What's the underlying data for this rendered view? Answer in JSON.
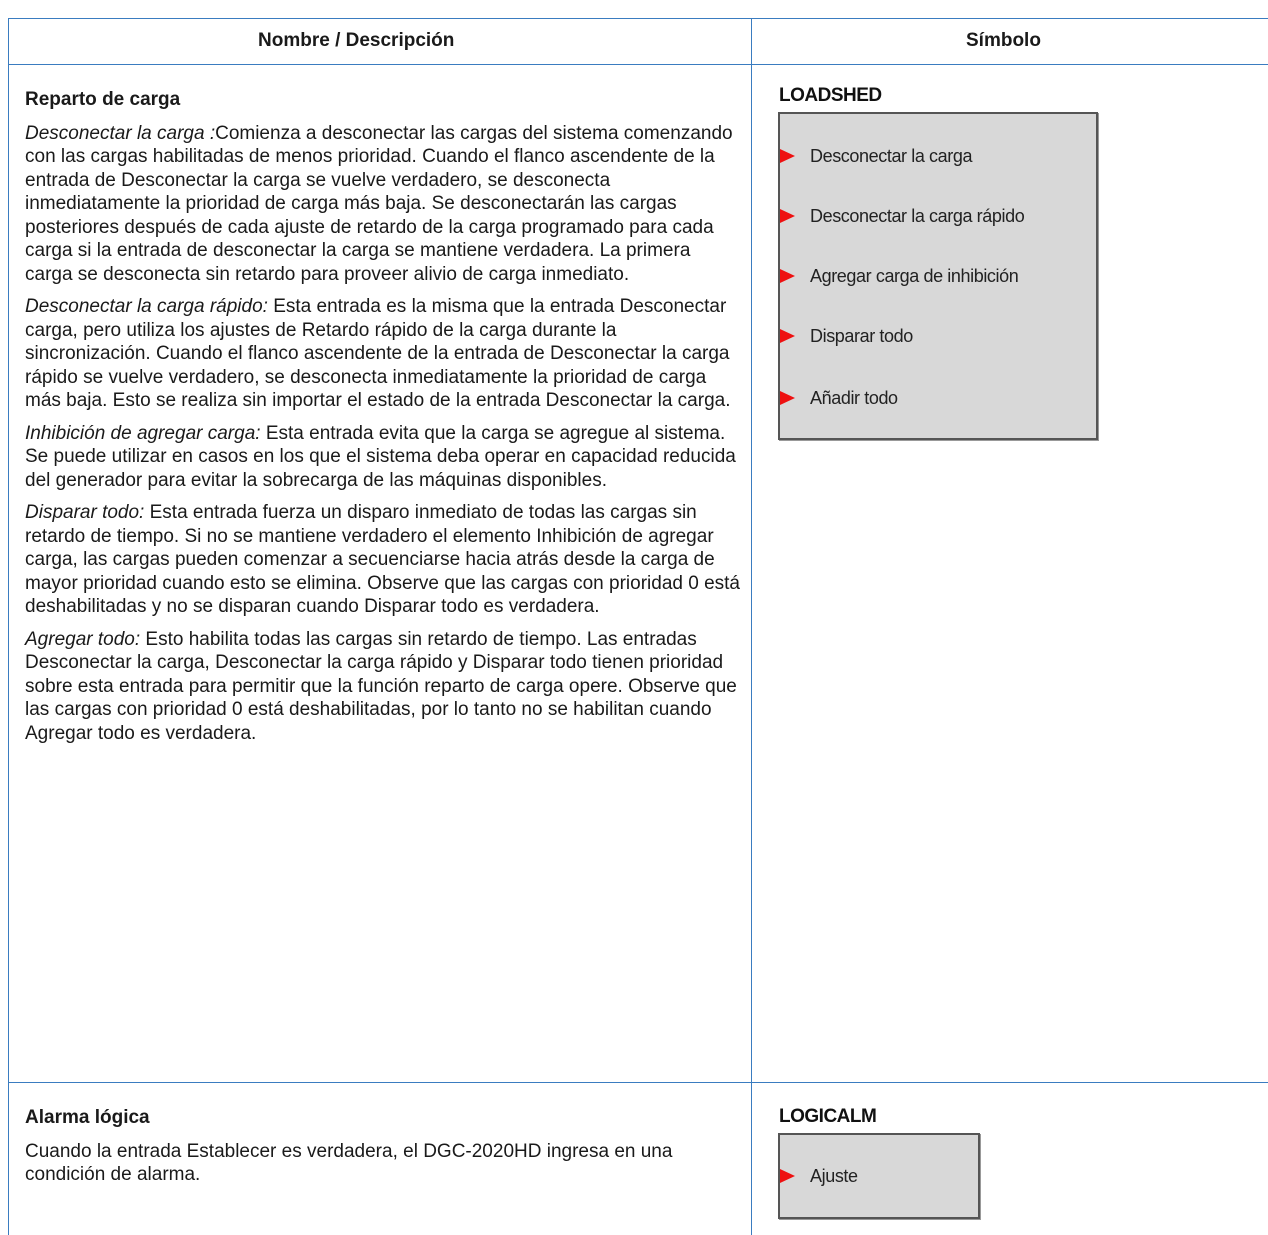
{
  "table": {
    "header": {
      "col1": "Nombre / Descripción",
      "col2": "Símbolo"
    }
  },
  "loadshed": {
    "title": "Reparto de carga",
    "p1": {
      "term": "Desconectar la carga :",
      "text": "Comienza a desconectar las cargas del sistema comenzando con las cargas habilitadas de menos prioridad. Cuando el flanco ascendente de la entrada de Desconectar la carga se vuelve verdadero, se desconecta inmediatamente la prioridad de carga más baja. Se desconectarán las cargas posteriores después de cada ajuste de retardo de la carga programado para cada carga si la entrada de desconectar la carga se mantiene verdadera. La primera carga se desconecta sin retardo para proveer alivio de carga inmediato."
    },
    "p2": {
      "term": "Desconectar la carga rápido:",
      "text": " Esta entrada es la misma que la entrada Desconectar carga, pero utiliza los ajustes de Retardo rápido de la carga durante la sincronización. Cuando el flanco ascendente de la entrada de Desconectar la carga rápido se vuelve verdadero, se desconecta inmediatamente la prioridad de carga más baja. Esto se realiza sin importar el estado de la entrada Desconectar la carga."
    },
    "p3": {
      "term": "Inhibición de agregar carga:",
      "text": " Esta entrada evita que la carga se agregue al sistema. Se puede utilizar en casos en los que el sistema deba operar en capacidad reducida del generador para evitar la sobrecarga de las máquinas disponibles."
    },
    "p4": {
      "term": "Disparar todo:",
      "text": " Esta entrada fuerza un disparo inmediato de todas las cargas sin retardo de tiempo. Si no se mantiene verdadero el elemento Inhibición de agregar carga, las cargas pueden comenzar a secuenciarse hacia atrás desde la carga de mayor prioridad cuando esto se elimina. Observe que las cargas con prioridad 0 está deshabilitadas y no se disparan cuando Disparar todo es verdadera."
    },
    "p5": {
      "term": "Agregar todo:",
      "text": " Esto habilita todas las cargas sin retardo de tiempo. Las entradas Desconectar la carga, Desconectar la carga rápido y Disparar todo tienen prioridad sobre esta entrada para permitir que la función reparto de carga opere. Observe que las cargas con prioridad 0 está deshabilitadas, por lo tanto no se habilitan cuando Agregar todo es verdadera."
    },
    "symbol": {
      "name": "LOADSHED",
      "ports": [
        "Desconectar la carga",
        "Desconectar la carga rápido",
        "Agregar carga de inhibición",
        "Disparar todo",
        "Añadir todo"
      ]
    }
  },
  "logicalm": {
    "title": "Alarma lógica",
    "text": "Cuando la entrada Establecer es verdadera, el DGC-2020HD ingresa en una condición de alarma.",
    "symbol": {
      "name": "LOGICALM",
      "ports": [
        "Ajuste"
      ]
    }
  },
  "colors": {
    "table_border": "#3a7cc0",
    "port_arrow": "#ee1111",
    "block_fill": "#d8d8d8"
  }
}
